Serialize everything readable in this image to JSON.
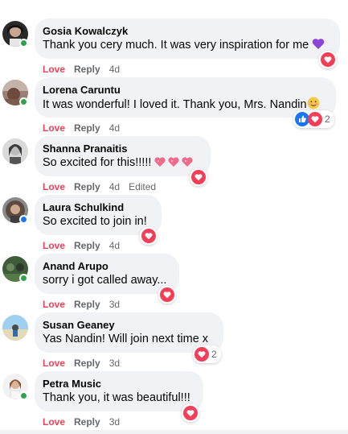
{
  "colors": {
    "love": "#f33e58",
    "bubble": "#f0f2f5",
    "meta": "#65676b",
    "online": "#31a24c",
    "like": "#1877f2"
  },
  "comments": [
    {
      "author": "Gosia Kowalczyk",
      "text": "Thank you cery much. It was very inspiration for me",
      "emoji": "purple-heart",
      "reaction": "Love",
      "reply": "Reply",
      "time": "4d",
      "edited": "",
      "reaction_count": "",
      "icons": [
        "heart-icon"
      ]
    },
    {
      "author": "Lorena Caruntu",
      "text": "It was wonderful! I loved it. Thank you, Mrs. Nandin",
      "emoji": "smiling-face",
      "reaction": "Love",
      "reply": "Reply",
      "time": "4d",
      "edited": "",
      "reaction_count": "2",
      "icons": [
        "like-icon",
        "heart-icon"
      ]
    },
    {
      "author": "Shanna Pranaitis",
      "text": "So excited for this!!!!!",
      "emoji": "sparkling-hearts-x3",
      "reaction": "Love",
      "reply": "Reply",
      "time": "4d",
      "edited": "Edited",
      "reaction_count": "",
      "icons": [
        "heart-icon"
      ]
    },
    {
      "author": "Laura Schulkind",
      "text": "So excited to join in!",
      "emoji": "",
      "reaction": "Love",
      "reply": "Reply",
      "time": "4d",
      "edited": "",
      "reaction_count": "",
      "icons": [
        "heart-icon"
      ]
    },
    {
      "author": "Anand Arupo",
      "text": "sorry i got called away...",
      "emoji": "",
      "reaction": "Love",
      "reply": "Reply",
      "time": "3d",
      "edited": "",
      "reaction_count": "",
      "icons": [
        "heart-icon"
      ]
    },
    {
      "author": "Susan Geaney",
      "text": "Yas Nandin! Will join next time x",
      "emoji": "",
      "reaction": "Love",
      "reply": "Reply",
      "time": "3d",
      "edited": "",
      "reaction_count": "2",
      "icons": [
        "heart-icon"
      ]
    },
    {
      "author": "Petra Music",
      "text": "Thank you, it was beautiful!!!",
      "emoji": "",
      "reaction": "Love",
      "reply": "Reply",
      "time": "3d",
      "edited": "",
      "reaction_count": "",
      "icons": [
        "heart-icon"
      ]
    }
  ]
}
